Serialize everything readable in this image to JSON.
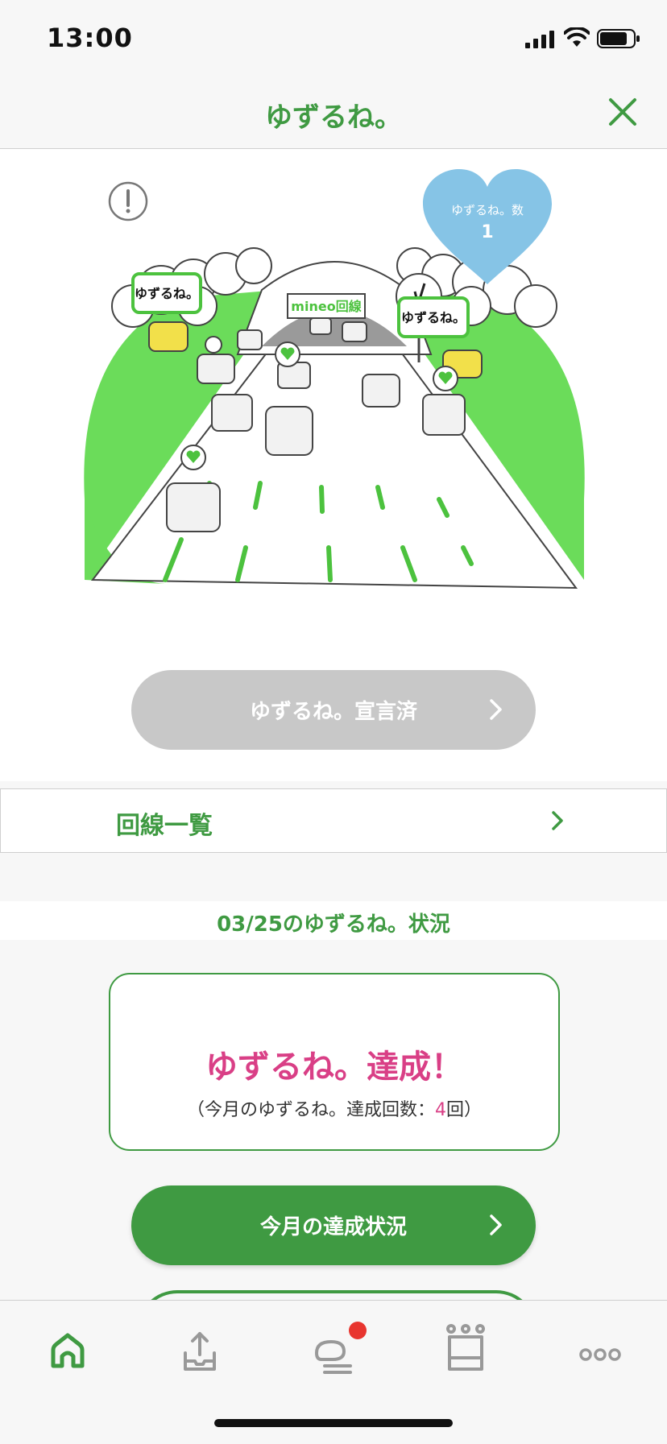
{
  "status_bar": {
    "time": "13:00"
  },
  "nav": {
    "title": "ゆずるね。"
  },
  "hero": {
    "heart_label": "ゆずるね。数",
    "heart_count": "1",
    "sign_text_left": "ゆずるね。",
    "sign_text_right": "ゆずるね。",
    "tunnel_sign": "mineo回線",
    "colors": {
      "grass": "#6bdc5a",
      "heart": "#86c4e6",
      "road_line": "#4cc23e"
    }
  },
  "declared_button": {
    "label": "ゆずるね。宣言済"
  },
  "line_list": {
    "label": "回線一覧"
  },
  "status_section": {
    "header": "03/25のゆずるね。状況",
    "achieve_title": "ゆずるね。達成！",
    "achieve_sub_prefix": "（今月のゆずるね。達成回数：",
    "achieve_count": "4",
    "achieve_sub_suffix": "回）"
  },
  "monthly_button": {
    "label": "今月の達成状況"
  },
  "tabbar": {
    "items": [
      {
        "icon": "home-icon",
        "active": true
      },
      {
        "icon": "upload-tray-icon",
        "active": false
      },
      {
        "icon": "chat-icon",
        "active": false,
        "badge": true
      },
      {
        "icon": "crown-icon",
        "active": false
      },
      {
        "icon": "more-icon",
        "active": false
      }
    ]
  },
  "colors": {
    "primary": "#3f9a42",
    "accent": "#d93f86",
    "disabled": "#c8c8c8"
  }
}
